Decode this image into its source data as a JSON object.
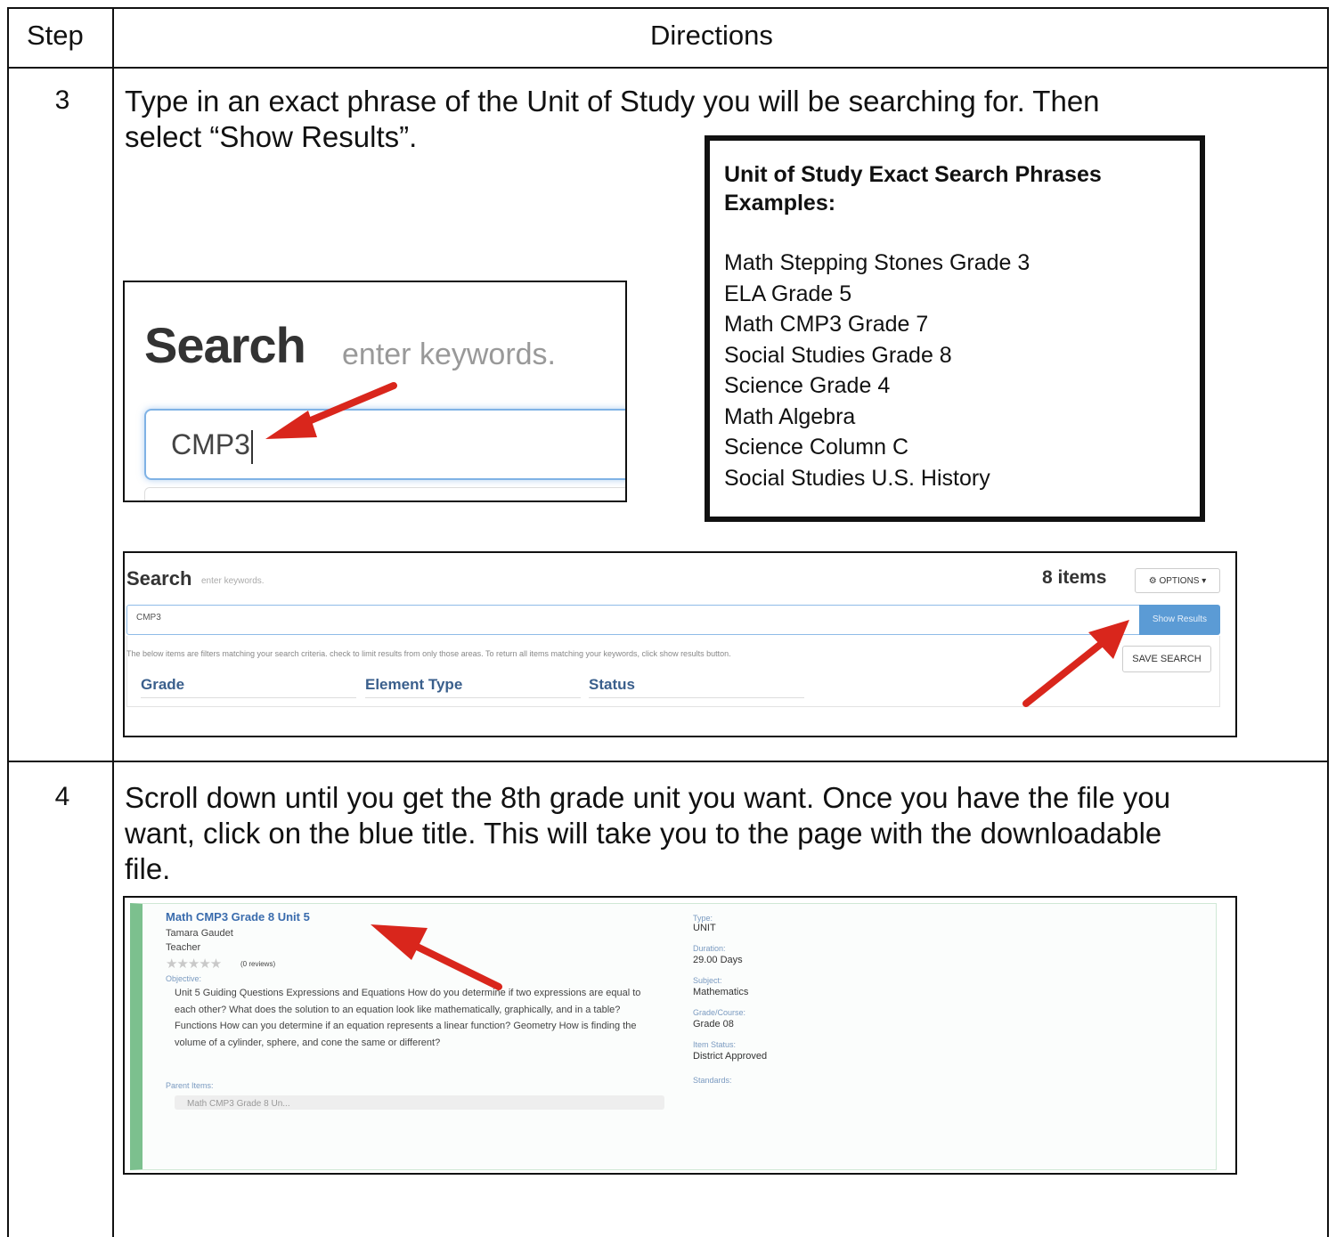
{
  "table": {
    "header": {
      "step": "Step",
      "directions": "Directions"
    },
    "rows": [
      {
        "step": "3",
        "text_line1": "Type in an exact phrase of the Unit of Study you will be searching for.  Then",
        "text_line2": "select “Show Results”."
      },
      {
        "step": "4",
        "text_line1": "Scroll down until you get the 8th grade unit you want.  Once you have the file you",
        "text_line2": "want, click on the blue title.  This will take you to the page with the downloadable",
        "text_line3": "file."
      }
    ]
  },
  "examples": {
    "title_line1": "Unit of Study Exact Search Phrases",
    "title_line2": "Examples:",
    "items": [
      "Math Stepping Stones Grade 3",
      "ELA Grade 5",
      "Math CMP3 Grade 7",
      "Social Studies Grade 8",
      "Science Grade 4",
      "Math Algebra",
      "Science Column C",
      "Social Studies U.S. History"
    ]
  },
  "zoom_search": {
    "title": "Search",
    "subtitle": "enter keywords.",
    "input_value": "CMP3"
  },
  "wide_search": {
    "title": "Search",
    "subtitle": "enter keywords.",
    "count": "8 items",
    "options_label": "⚙ OPTIONS ▾",
    "input_value": "CMP3",
    "show_results": "Show Results",
    "hint": "The below items are filters matching your search criteria. check to limit results from only those areas. To return all items matching your keywords, click show results button.",
    "save_search": "SAVE SEARCH",
    "columns": [
      "Grade",
      "Element Type",
      "Status"
    ]
  },
  "result_card": {
    "title": "Math CMP3 Grade 8 Unit 5",
    "author": "Tamara Gaudet",
    "role": "Teacher",
    "stars": "★★★★★",
    "reviews": "(0 reviews)",
    "objective_label": "Objective:",
    "objective": "Unit 5 Guiding Questions Expressions and Equations How do you determine if two expressions are equal to each other? What does the solution to an equation look like mathematically, graphically, and in a table? Functions How can you determine if an equation represents a linear function? Geometry How is finding the volume of a cylinder, sphere, and cone the same or different?",
    "parent_label": "Parent Items:",
    "parent_value": "Math CMP3 Grade 8 Un...",
    "type_label": "Type:",
    "type_value": "UNIT",
    "duration_label": "Duration:",
    "duration_value": "29.00 Days",
    "subject_label": "Subject:",
    "subject_value": "Mathematics",
    "grade_label": "Grade/Course:",
    "grade_value": "Grade 08",
    "status_label": "Item Status:",
    "status_value": "District Approved",
    "standards_label": "Standards:"
  },
  "colors": {
    "arrow": "#d9261c",
    "link_blue": "#3a6cad",
    "accent_green": "#7cc08e",
    "button_blue": "#5b9bd5"
  }
}
